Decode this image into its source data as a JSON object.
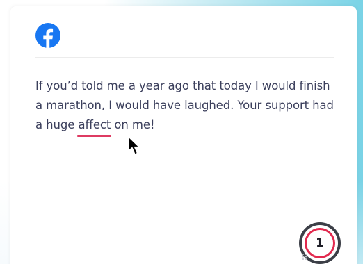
{
  "window": {
    "app": "Grammarly-style writing assistant over Facebook post"
  },
  "post": {
    "platform_icon": "facebook-icon",
    "text_part1": "If you’d told me a year ago that today I would finish a marathon, I would have laughed. Your support had a huge ",
    "flagged_word": "affect",
    "text_part2": " on me!"
  },
  "assistant_badge": {
    "count": "1",
    "accent_color": "#e2294e"
  },
  "colors": {
    "facebook_blue": "#1877f2",
    "underline": "#de3b62",
    "text": "#3b3f5c"
  }
}
